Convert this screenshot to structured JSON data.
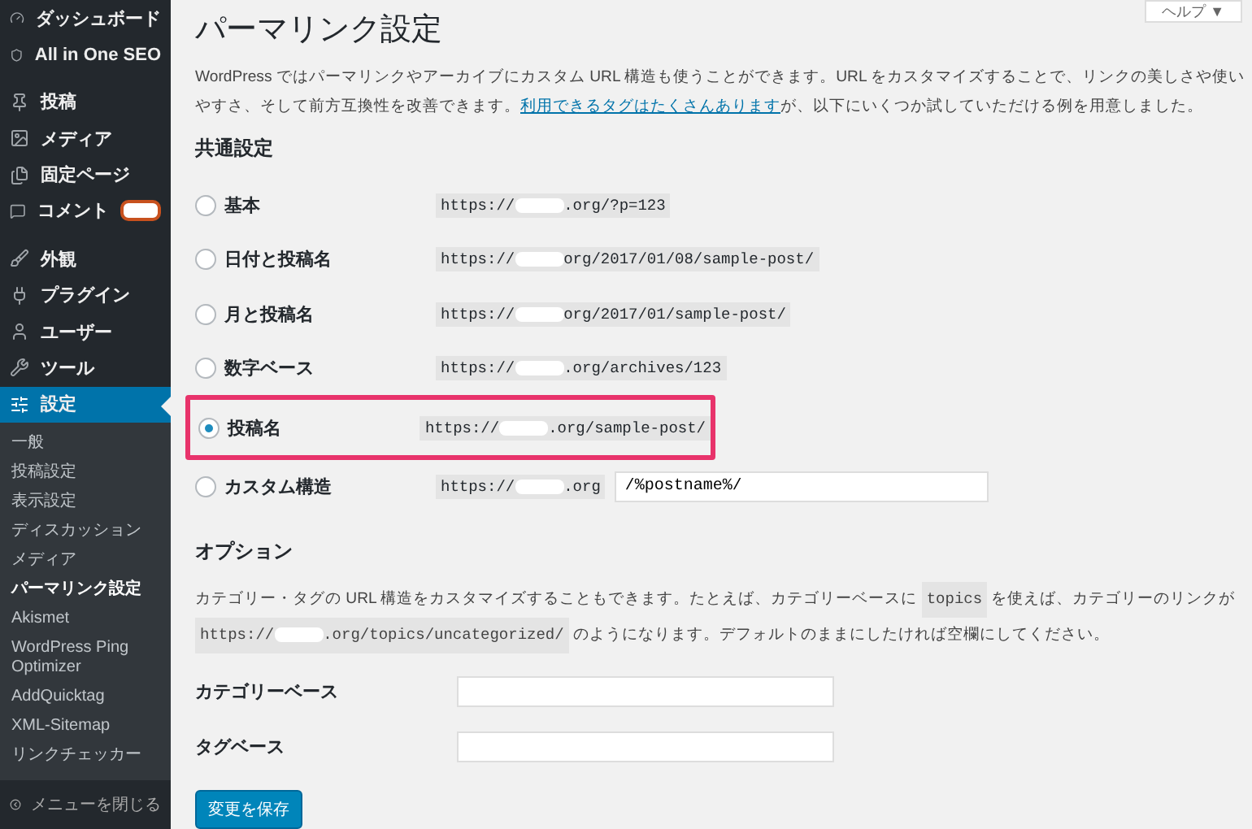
{
  "sidebar": {
    "items": [
      {
        "label": "ダッシュボード",
        "selected": false
      },
      {
        "label": "All in One SEO",
        "selected": false
      },
      {
        "label": "投稿",
        "selected": false
      },
      {
        "label": "メディア",
        "selected": false
      },
      {
        "label": "固定ページ",
        "selected": false
      },
      {
        "label": "コメント",
        "selected": false,
        "redacted_badge": true
      },
      {
        "label": "外観",
        "selected": false
      },
      {
        "label": "プラグイン",
        "selected": false
      },
      {
        "label": "ユーザー",
        "selected": false
      },
      {
        "label": "ツール",
        "selected": false
      },
      {
        "label": "設定",
        "selected": true
      }
    ],
    "submenu": [
      {
        "label": "一般",
        "selected": false
      },
      {
        "label": "投稿設定",
        "selected": false
      },
      {
        "label": "表示設定",
        "selected": false
      },
      {
        "label": "ディスカッション",
        "selected": false
      },
      {
        "label": "メディア",
        "selected": false
      },
      {
        "label": "パーマリンク設定",
        "selected": true
      },
      {
        "label": "Akismet",
        "selected": false
      },
      {
        "label": "WordPress Ping Optimizer",
        "selected": false
      },
      {
        "label": "AddQuicktag",
        "selected": false
      },
      {
        "label": "XML-Sitemap",
        "selected": false
      },
      {
        "label": "リンクチェッカー",
        "selected": false
      }
    ],
    "collapse": "メニューを閉じる"
  },
  "help_button": "ヘルプ ▼",
  "title": "パーマリンク設定",
  "intro": {
    "before": "WordPress ではパーマリンクやアーカイブにカスタム URL 構造も使うことができます。URL をカスタマイズすることで、リンクの美しさや使いやすさ、そして前方互換性を改善できます。",
    "link": "利用できるタグはたくさんあります",
    "after": "が、以下にいくつか試していただける例を用意しました。"
  },
  "common_heading": "共通設定",
  "permalinks": [
    {
      "kind": "preset",
      "label": "基本",
      "url_prefix": "https://",
      "url_suffix": ".org/?p=123",
      "selected": false,
      "highlighted": false
    },
    {
      "kind": "preset",
      "label": "日付と投稿名",
      "url_prefix": "https://",
      "url_suffix": "org/2017/01/08/sample-post/",
      "selected": false,
      "highlighted": false
    },
    {
      "kind": "preset",
      "label": "月と投稿名",
      "url_prefix": "https://",
      "url_suffix": "org/2017/01/sample-post/",
      "selected": false,
      "highlighted": false
    },
    {
      "kind": "preset",
      "label": "数字ベース",
      "url_prefix": "https://",
      "url_suffix": ".org/archives/123",
      "selected": false,
      "highlighted": false
    },
    {
      "kind": "preset",
      "label": "投稿名",
      "url_prefix": "https://",
      "url_suffix": ".org/sample-post/",
      "selected": true,
      "highlighted": true
    },
    {
      "kind": "custom",
      "label": "カスタム構造",
      "url_prefix": "https://",
      "url_suffix": ".org",
      "value": "/%postname%/",
      "selected": false,
      "highlighted": false
    }
  ],
  "options": {
    "heading": "オプション",
    "desc_1": "カテゴリー・タグの URL 構造をカスタマイズすることもできます。たとえば、カテゴリーベースに",
    "code_1": "topics",
    "desc_2": "を使えば、カテゴリーのリンクが",
    "code_2_prefix": "https://",
    "code_2_suffix": ".org/topics/uncategorized/",
    "desc_3": "のようになります。デフォルトのままにしたければ空欄にしてください。",
    "fields": [
      {
        "label": "カテゴリーベース"
      },
      {
        "label": "タグベース"
      }
    ]
  },
  "save_button": "変更を保存"
}
